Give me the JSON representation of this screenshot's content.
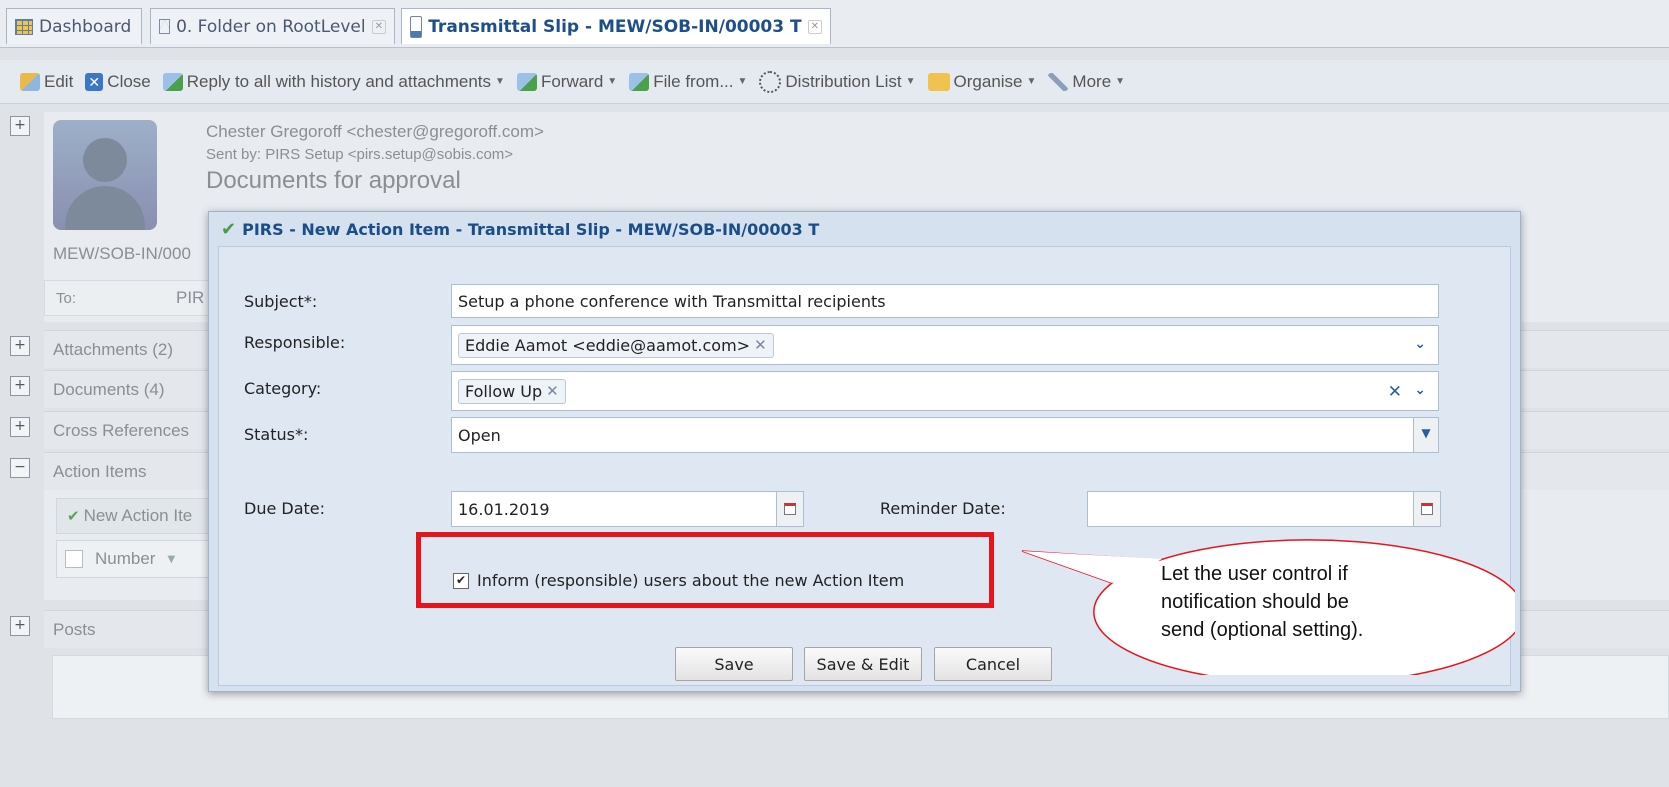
{
  "tabs": [
    {
      "label": "Dashboard",
      "icon": "grid-icon"
    },
    {
      "label": "0. Folder on RootLevel",
      "icon": "envelope-icon"
    },
    {
      "label": "Transmittal Slip - MEW/SOB-IN/00003 T",
      "icon": "document-icon"
    }
  ],
  "toolbar": {
    "edit": "Edit",
    "close": "Close",
    "reply": "Reply to all with history and attachments",
    "forward": "Forward",
    "file_from": "File from...",
    "distribution": "Distribution List",
    "organise": "Organise",
    "more": "More"
  },
  "message": {
    "from": "Chester Gregoroff <chester@gregoroff.com>",
    "sent_by": "Sent by: PIRS Setup <pirs.setup@sobis.com>",
    "subject": "Documents for approval",
    "number": "MEW/SOB-IN/000",
    "to_label": "To:",
    "to_value": "PIR"
  },
  "sections": {
    "attachments": "Attachments (2)",
    "documents": "Documents (4)",
    "cross_references": "Cross References",
    "action_items": "Action Items",
    "new_action_item": "New Action Ite",
    "number_col": "Number",
    "posts": "Posts"
  },
  "dialog": {
    "title": "PIRS - New Action Item - Transmittal Slip - MEW/SOB-IN/00003 T",
    "subject_label": "Subject*:",
    "subject_value": "Setup a phone conference with Transmittal recipients",
    "responsible_label": "Responsible:",
    "responsible_value": "Eddie Aamot <eddie@aamot.com>",
    "category_label": "Category:",
    "category_value": "Follow Up",
    "status_label": "Status*:",
    "status_value": "Open",
    "due_date_label": "Due Date:",
    "due_date_value": "16.01.2019",
    "reminder_label": "Reminder Date:",
    "reminder_value": "",
    "inform_label": "Inform (responsible) users about the new Action Item",
    "inform_checked": true,
    "save": "Save",
    "save_edit": "Save & Edit",
    "cancel": "Cancel"
  },
  "callout": {
    "line1": "Let the user control if",
    "line2": "notification should be",
    "line3": "send (optional setting)."
  },
  "colors": {
    "annotation_red": "#e8141c",
    "title_blue": "#1b4d89"
  }
}
